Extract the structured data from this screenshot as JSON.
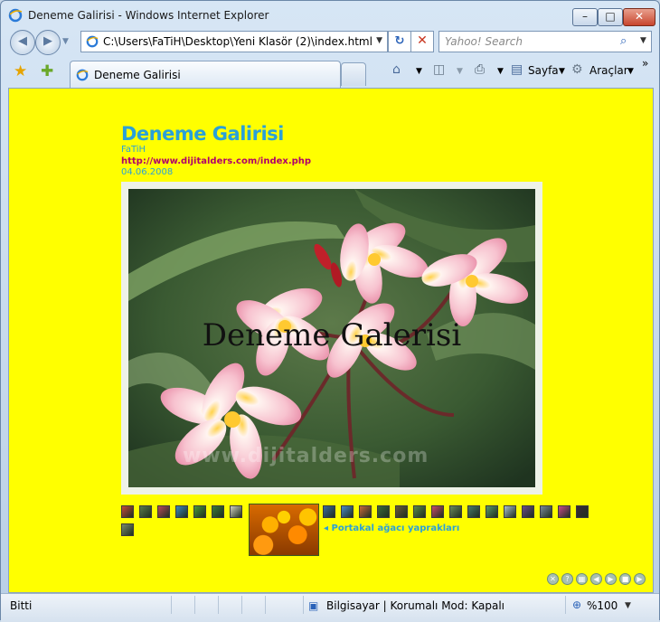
{
  "window": {
    "title": "Deneme Galirisi - Windows Internet Explorer",
    "minimize_glyph": "–",
    "maximize_glyph": "□",
    "close_glyph": "✕"
  },
  "nav": {
    "back_glyph": "◀",
    "forward_glyph": "▶",
    "address": "C:\\Users\\FaTiH\\Desktop\\Yeni Klasör (2)\\index.html",
    "refresh_glyph": "↻",
    "stop_glyph": "✕",
    "search_placeholder": "Yahoo! Search"
  },
  "tabs": {
    "favorites_icon": "star-icon",
    "add_favorites_icon": "add-favorites-icon",
    "active_tab_label": "Deneme Galirisi"
  },
  "commands": {
    "home_icon": "home-icon",
    "feeds_icon": "rss-icon",
    "print_icon": "print-icon",
    "page_label": "Sayfa",
    "tools_label": "Araçlar",
    "more_glyph": "»"
  },
  "gallery": {
    "title": "Deneme Galirisi",
    "author": "FaTiH",
    "url": "http://www.dijitalders.com/index.php",
    "date": "04.06.2008",
    "photo_caption": "Deneme Galerisi",
    "watermark": "www.dijitalders.com",
    "thumb_caption": "◂ Portakal ağacı yaprakları",
    "thumbnail_colors": [
      "#c44a3a",
      "#5a7a4a",
      "#b84a5a",
      "#3a8ac0",
      "#4a9a3a",
      "#3a7a3a",
      "#d0d0c0",
      "#3a6aa0",
      "#4a8ac8",
      "#c86a3a",
      "#3a6a3a",
      "#6a5a3a",
      "#5a8a4a",
      "#c84a6a",
      "#6a8a5a",
      "#4a7a6a",
      "#5a9a6a",
      "#aac0d0",
      "#6a4a8a",
      "#7a8a9a",
      "#c84a8a",
      "#3a2a3a",
      "#7a8a6a"
    ]
  },
  "status": {
    "left": "Bitti",
    "zone": "Bilgisayar | Korumalı Mod: Kapalı",
    "zoom": "%100"
  },
  "colors": {
    "page_background": "#ffff00",
    "title_blue": "#2aa0d8",
    "url_magenta": "#b0006a"
  }
}
